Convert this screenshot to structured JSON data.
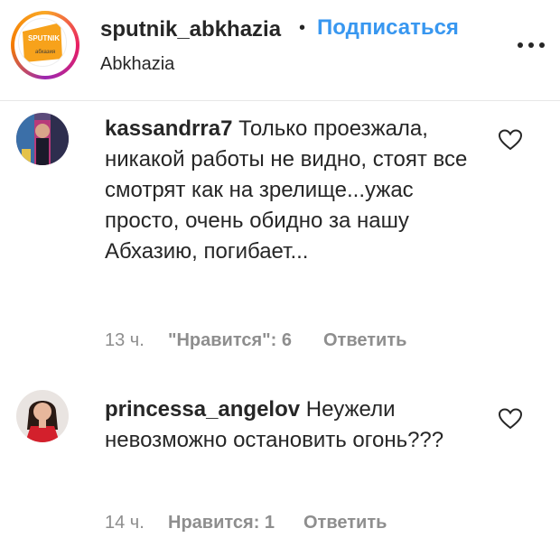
{
  "post_header": {
    "username": "sputnik_abkhazia",
    "separator": "•",
    "follow_label": "Подписаться",
    "location": "Abkhazia",
    "logo_text_top": "SPUTNIK",
    "logo_text_bottom": "абхазия",
    "more_icon": "more-horizontal-icon"
  },
  "comments": [
    {
      "username": "kassandrra7",
      "text": "Только проезжала, никакой работы не видно, стоят все смотрят как на зрелище...ужас просто, очень обидно за нашу Абхазию, погибает...",
      "time": "13 ч.",
      "likes_label": "\"Нравится\": 6",
      "reply_label": "Ответить"
    },
    {
      "username": "princessa_angelov",
      "text": "Неужели невозможно остановить огонь???",
      "time": "14 ч.",
      "likes_label": "Нравится: 1",
      "reply_label": "Ответить"
    }
  ],
  "colors": {
    "link_blue": "#3897f0",
    "text_dark": "#262626",
    "text_muted": "#8e8e8e",
    "logo_orange": "#f7a21b"
  }
}
